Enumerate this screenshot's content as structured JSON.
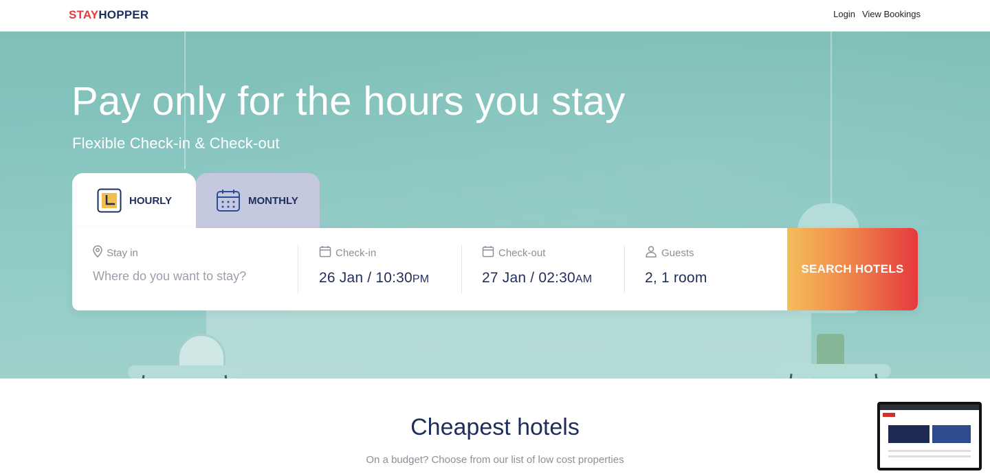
{
  "brand": {
    "part1": "STAY",
    "part2": "HOPPER"
  },
  "nav": {
    "login": "Login",
    "view_bookings": "View Bookings"
  },
  "hero": {
    "title": "Pay only for the hours you stay",
    "subtitle": "Flexible Check-in & Check-out"
  },
  "tabs": {
    "hourly": "HOURLY",
    "monthly": "MONTHLY"
  },
  "search": {
    "stay_in_label": "Stay in",
    "stay_in_placeholder": "Where do you want to stay?",
    "checkin_label": "Check-in",
    "checkin_date": "26 Jan / 10:30",
    "checkin_ampm": "PM",
    "checkout_label": "Check-out",
    "checkout_date": "27 Jan / 02:30",
    "checkout_ampm": "AM",
    "guests_label": "Guests",
    "guests_value": "2, 1 room",
    "button": "SEARCH HOTELS"
  },
  "section": {
    "title": "Cheapest hotels",
    "subtitle": "On a budget? Choose from our list of low cost properties"
  },
  "colors": {
    "brand_red": "#e23b3b",
    "navy": "#1f2d5a",
    "accent_orange": "#f08a4b"
  }
}
